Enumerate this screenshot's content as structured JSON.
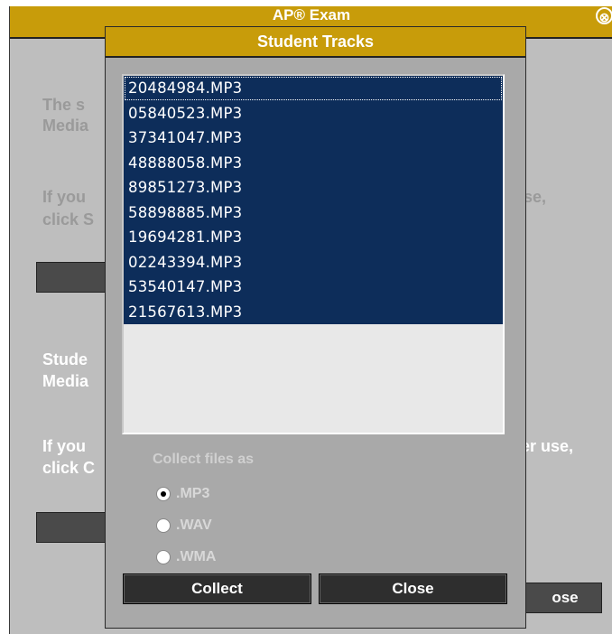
{
  "background_window": {
    "title": "AP® Exam",
    "close_glyph": "⊗",
    "paragraph1_line1": "The s",
    "paragraph1_line2": "Media",
    "paragraph2_line1_left": "If you",
    "paragraph2_line1_right": "se,",
    "paragraph2_line2": "click S",
    "section_line1": "Stude",
    "section_line2": "Media",
    "paragraph3_line1_left": "If you",
    "paragraph3_line1_right": "er use,",
    "paragraph3_line2": "click C",
    "partial_button_label": "ose"
  },
  "dialog": {
    "title": "Student Tracks",
    "tracks": [
      "20484984.MP3",
      "05840523.MP3",
      "37341047.MP3",
      "48888058.MP3",
      "89851273.MP3",
      "58898885.MP3",
      "19694281.MP3",
      "02243394.MP3",
      "53540147.MP3",
      "21567613.MP3"
    ],
    "collect_label": "Collect files as",
    "formats": [
      {
        "label": ".MP3",
        "checked": true
      },
      {
        "label": ".WAV",
        "checked": false
      },
      {
        "label": ".WMA",
        "checked": false
      }
    ],
    "collect_button": "Collect",
    "close_button": "Close"
  },
  "colors": {
    "title_bar": "#c89c0a",
    "selection": "#0d2d5a",
    "window_bg": "#bebebe",
    "dialog_bg": "#a9a9a9"
  }
}
